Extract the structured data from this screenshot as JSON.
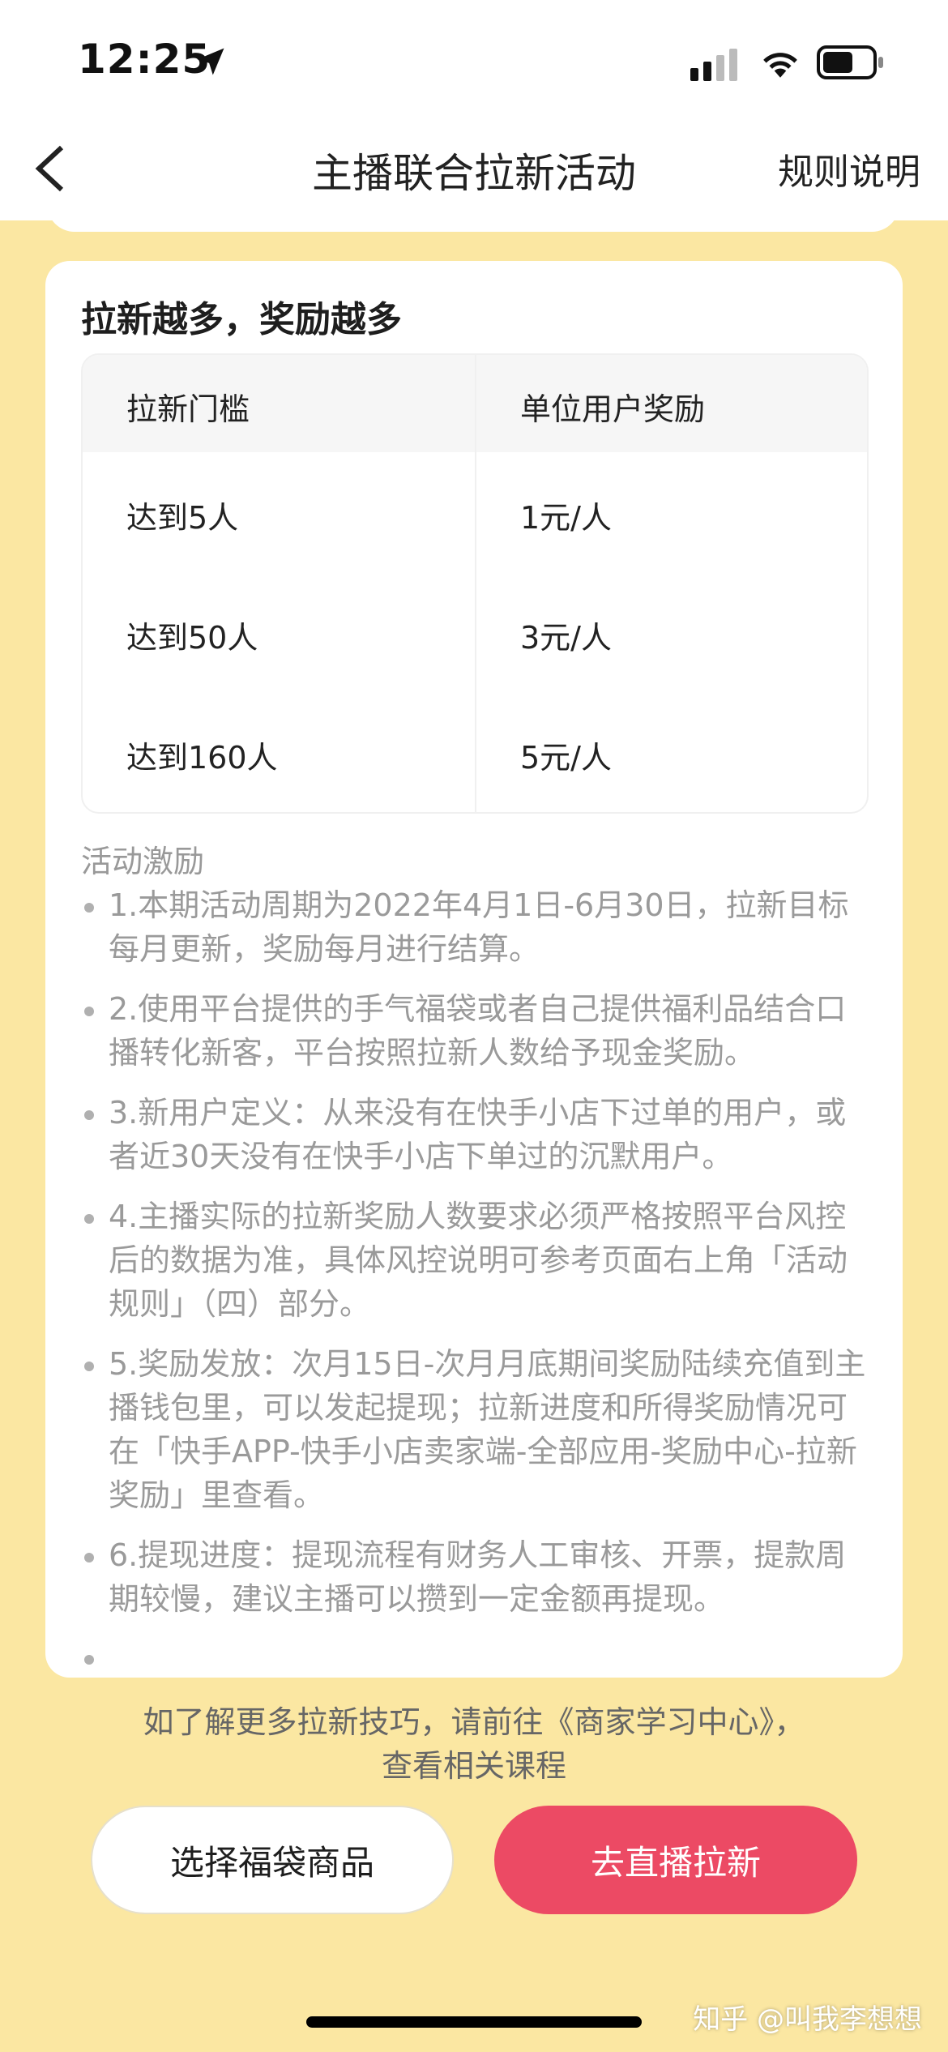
{
  "status_bar": {
    "time": "12:25"
  },
  "nav": {
    "title": "主播联合拉新活动",
    "rule_link": "规则说明"
  },
  "card": {
    "title": "拉新越多，奖励越多",
    "table": {
      "headers": [
        "拉新门槛",
        "单位用户奖励"
      ],
      "rows": [
        [
          "达到5人",
          "1元/人"
        ],
        [
          "达到50人",
          "3元/人"
        ],
        [
          "达到160人",
          "5元/人"
        ]
      ]
    },
    "section_title": "活动激励",
    "rules": [
      "1.本期活动周期为2022年4月1日-6月30日，拉新目标每月更新，奖励每月进行结算。",
      "2.使用平台提供的手气福袋或者自己提供福利品结合口播转化新客，平台按照拉新人数给予现金奖励。",
      "3.新用户定义：从来没有在快手小店下过单的用户，或者近30天没有在快手小店下单过的沉默用户。",
      "4.主播实际的拉新奖励人数要求必须严格按照平台风控后的数据为准，具体风控说明可参考页面右上角「活动规则」（四）部分。",
      "5.奖励发放：次月15日-次月月底期间奖励陆续充值到主播钱包里，可以发起提现；拉新进度和所得奖励情况可在「快手APP-快手小店卖家端-全部应用-奖励中心-拉新奖励」里查看。",
      "6.提现进度：提现流程有财务人工审核、开票，提款周期较慢，建议主播可以攒到一定金额再提现。"
    ]
  },
  "tip": {
    "line1": "如了解更多拉新技巧，请前往《商家学习中心》，",
    "line2": "查看相关课程"
  },
  "buttons": {
    "left": "选择福袋商品",
    "right": "去直播拉新"
  },
  "watermark": "知乎 @叫我李想想",
  "colors": {
    "background": "#fbe7a2",
    "primary_button": "#ec4a64"
  }
}
